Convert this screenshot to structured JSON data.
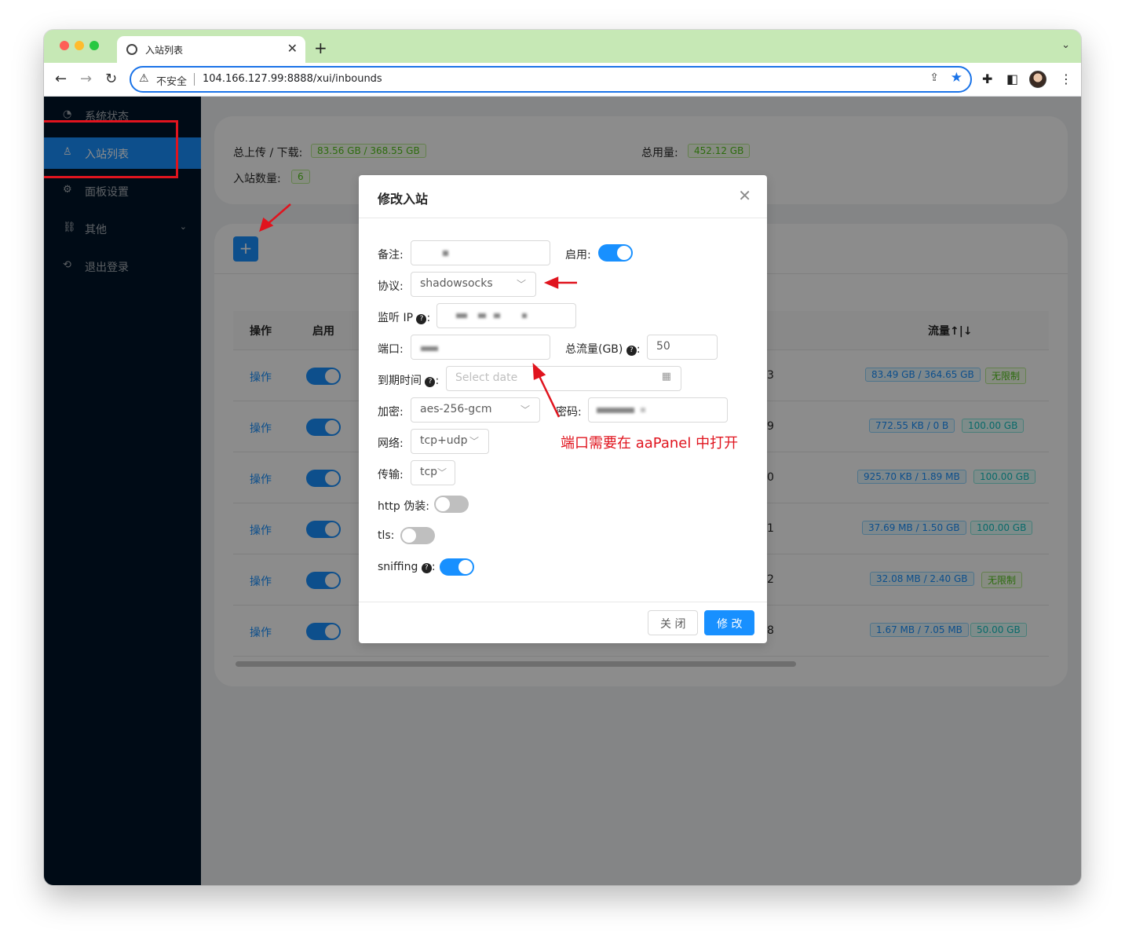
{
  "browser": {
    "tab_title": "入站列表",
    "security_label": "不安全",
    "url": "104.166.127.99:8888/xui/inbounds"
  },
  "sidebar": {
    "items": [
      {
        "label": "系统状态",
        "icon": "dashboard-icon"
      },
      {
        "label": "入站列表",
        "icon": "user-icon",
        "active": true
      },
      {
        "label": "面板设置",
        "icon": "setting-icon"
      },
      {
        "label": "其他",
        "icon": "link-icon",
        "has_submenu": true
      },
      {
        "label": "退出登录",
        "icon": "logout-icon"
      }
    ]
  },
  "stats": {
    "upload_download_label": "总上传 / 下载:",
    "upload_download_value": "83.56 GB / 368.55 GB",
    "total_usage_label": "总用量:",
    "total_usage_value": "452.12 GB",
    "inbound_count_label": "入站数量:",
    "inbound_count_value": "6"
  },
  "table": {
    "headers": {
      "op": "操作",
      "enable": "启用",
      "traffic": "流量↑|↓"
    },
    "rows": [
      {
        "op": "操作",
        "enabled": true,
        "num": "3",
        "traffic": "83.49 GB / 364.65 GB",
        "quota": "无限制",
        "quota_type": "green"
      },
      {
        "op": "操作",
        "enabled": true,
        "num": "9",
        "traffic": "772.55 KB / 0 B",
        "quota": "100.00 GB",
        "quota_type": "cyan"
      },
      {
        "op": "操作",
        "enabled": true,
        "num": "0",
        "traffic": "925.70 KB / 1.89 MB",
        "quota": "100.00 GB",
        "quota_type": "cyan"
      },
      {
        "op": "操作",
        "enabled": true,
        "num": "1",
        "traffic": "37.69 MB / 1.50 GB",
        "quota": "100.00 GB",
        "quota_type": "cyan"
      },
      {
        "op": "操作",
        "enabled": true,
        "num": "2",
        "traffic": "32.08 MB / 2.40 GB",
        "quota": "无限制",
        "quota_type": "green"
      },
      {
        "op": "操作",
        "enabled": true,
        "num": "8",
        "traffic": "1.67 MB / 7.05 MB",
        "quota": "50.00 GB",
        "quota_type": "cyan"
      }
    ]
  },
  "modal": {
    "title": "修改入站",
    "remark_label": "备注:",
    "enable_label": "启用:",
    "protocol_label": "协议:",
    "protocol_value": "shadowsocks",
    "listen_ip_label": "监听 IP",
    "port_label": "端口:",
    "total_traffic_label": "总流量(GB)",
    "total_traffic_value": "50",
    "expiry_label": "到期时间",
    "expiry_placeholder": "Select date",
    "encryption_label": "加密:",
    "encryption_value": "aes-256-gcm",
    "password_label": "密码:",
    "network_label": "网络:",
    "network_value": "tcp+udp",
    "transport_label": "传输:",
    "transport_value": "tcp",
    "http_label": "http 伪装:",
    "tls_label": "tls:",
    "sniffing_label": "sniffing",
    "close_button": "关 闭",
    "submit_button": "修 改",
    "switches": {
      "enable": true,
      "http": false,
      "tls": false,
      "sniffing": true
    }
  },
  "annotation_text": "端口需要在 aaPanel 中打开",
  "colors": {
    "primary": "#1890ff",
    "sider": "#001529",
    "annotation": "#e0141e",
    "tabbar": "#c6e8b5"
  }
}
